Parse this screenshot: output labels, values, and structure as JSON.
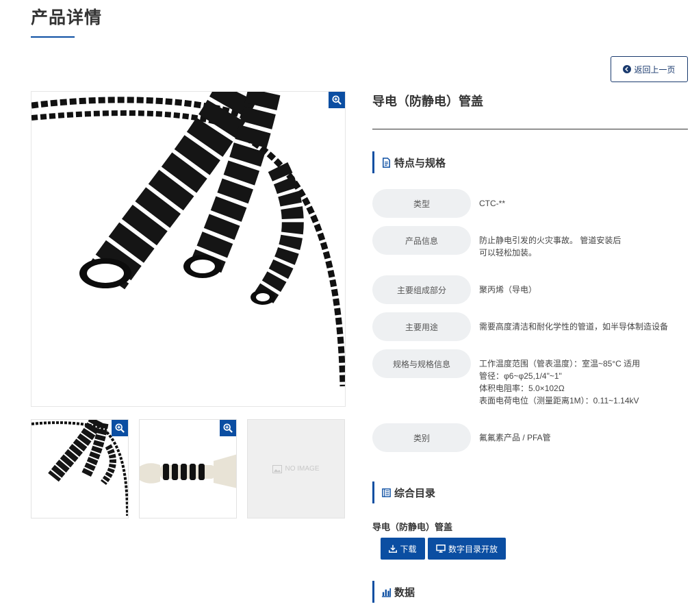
{
  "page": {
    "title": "产品详情"
  },
  "back_button": {
    "label": "返回上一页"
  },
  "gallery": {
    "no_image_label": "NO IMAGE"
  },
  "product": {
    "name": "导电（防静电）管盖"
  },
  "spec_section": {
    "title": "特点与规格"
  },
  "specs": [
    {
      "key": "类型",
      "lines": [
        "CTC-**"
      ]
    },
    {
      "key": "产品信息",
      "lines": [
        "防止静电引发的火灾事故。 管道安装后",
        "可以轻松加装。"
      ]
    },
    {
      "key": "主要组成部分",
      "lines": [
        "聚丙烯（导电）"
      ]
    },
    {
      "key": "主要用途",
      "lines": [
        "需要高度清洁和耐化学性的管道，如半导体制造设备"
      ]
    },
    {
      "key": "规格与规格信息",
      "lines": [
        "工作温度范围（管表温度）：室温~85°C 适用",
        "管径：φ6~φ25,1/4\"~1\"",
        "体积电阻率：5.0×102Ω",
        "表面电荷电位（测量距离1M）：0.11~1.14kV"
      ]
    },
    {
      "key": "类别",
      "lines": [
        "氟氟素产品 / PFA管"
      ]
    }
  ],
  "catalog_section": {
    "title": "综合目录",
    "item_name": "导电（防静电）管盖",
    "download_label": "下载",
    "digital_label": "数字目录开放"
  },
  "data_section": {
    "title": "数据"
  },
  "colors": {
    "accent": "#0b4ea2",
    "pill_bg": "#eef0f2",
    "back_border": "#1a3a6e"
  }
}
